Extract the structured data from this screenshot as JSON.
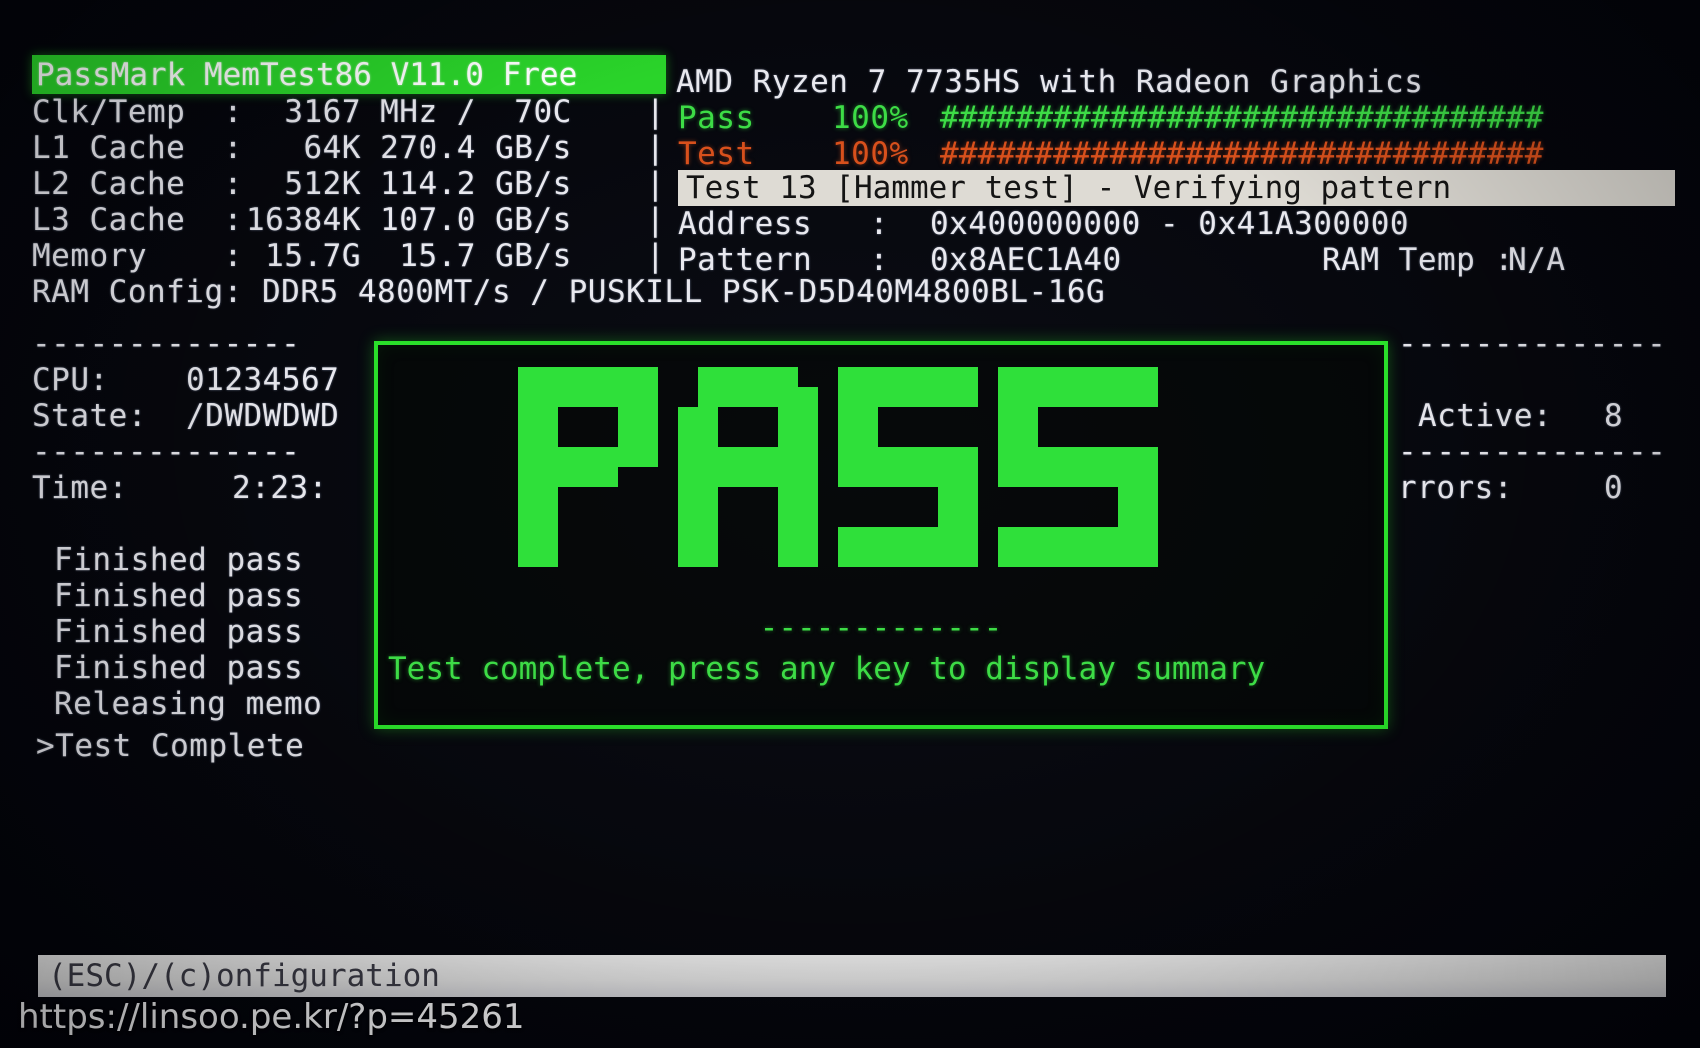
{
  "app": {
    "title": "PassMark MemTest86 V11.0 Free",
    "cpu_model": "AMD Ryzen 7 7735HS with Radeon Graphics"
  },
  "colors": {
    "title_bg": "#2ad42a",
    "pass_green": "#3ddc46",
    "test_orange": "#d8501c",
    "highlight_bg": "#dedbd4",
    "text_white": "#e9e9ef",
    "screen_bg": "#05070d"
  },
  "system_info": {
    "rows": [
      {
        "label": "Clk/Temp  :",
        "value": "  3167 MHz /  70C"
      },
      {
        "label": "L1 Cache  :",
        "value": "   64K 270.4 GB/s"
      },
      {
        "label": "L2 Cache  :",
        "value": "  512K 114.2 GB/s"
      },
      {
        "label": "L3 Cache  :",
        "value": "16384K 107.0 GB/s"
      },
      {
        "label": "Memory    :",
        "value": " 15.7G  15.7 GB/s"
      }
    ],
    "ram_config_label": "RAM Config:",
    "ram_config_value": "DDR5 4800MT/s / PUSKILL PSK-D5D40M4800BL-16G"
  },
  "progress": {
    "pass_label": "Pass",
    "pass_percent": "100%",
    "pass_bar": "################################",
    "test_label": "Test",
    "test_percent": "100%",
    "test_bar": "################################",
    "current_test": "Test 13 [Hammer test] - Verifying pattern"
  },
  "test_details": {
    "address_label": "Address   :",
    "address_value": "0x400000000 - 0x41A300000",
    "pattern_label": "Pattern   :",
    "pattern_value": "0x8AEC1A40",
    "ram_temp_label": "RAM Temp :",
    "ram_temp_value": "N/A"
  },
  "cpu_status": {
    "divider": "--------------",
    "cpu_label": "CPU:",
    "cpu_value": "01234567",
    "state_label": "State:",
    "state_value": "/DWDWDWD",
    "time_label": "Time:",
    "time_value": "2:23:"
  },
  "right_status": {
    "divider": "--------------",
    "active_label": "Active:",
    "active_value": "8",
    "errors_label": "rrors:",
    "errors_value": "0"
  },
  "log": {
    "lines": [
      "Finished pass",
      "Finished pass",
      "Finished pass",
      "Finished pass",
      "Releasing memo"
    ],
    "final_line": ">Test Complete"
  },
  "pass_panel": {
    "banner_text": "PASS",
    "divider": "-------------",
    "message": "Test complete, press any key to display summary"
  },
  "footer": {
    "menu": "(ESC)/(c)onfiguration",
    "watermark": "https://linsoo.pe.kr/?p=45261"
  }
}
